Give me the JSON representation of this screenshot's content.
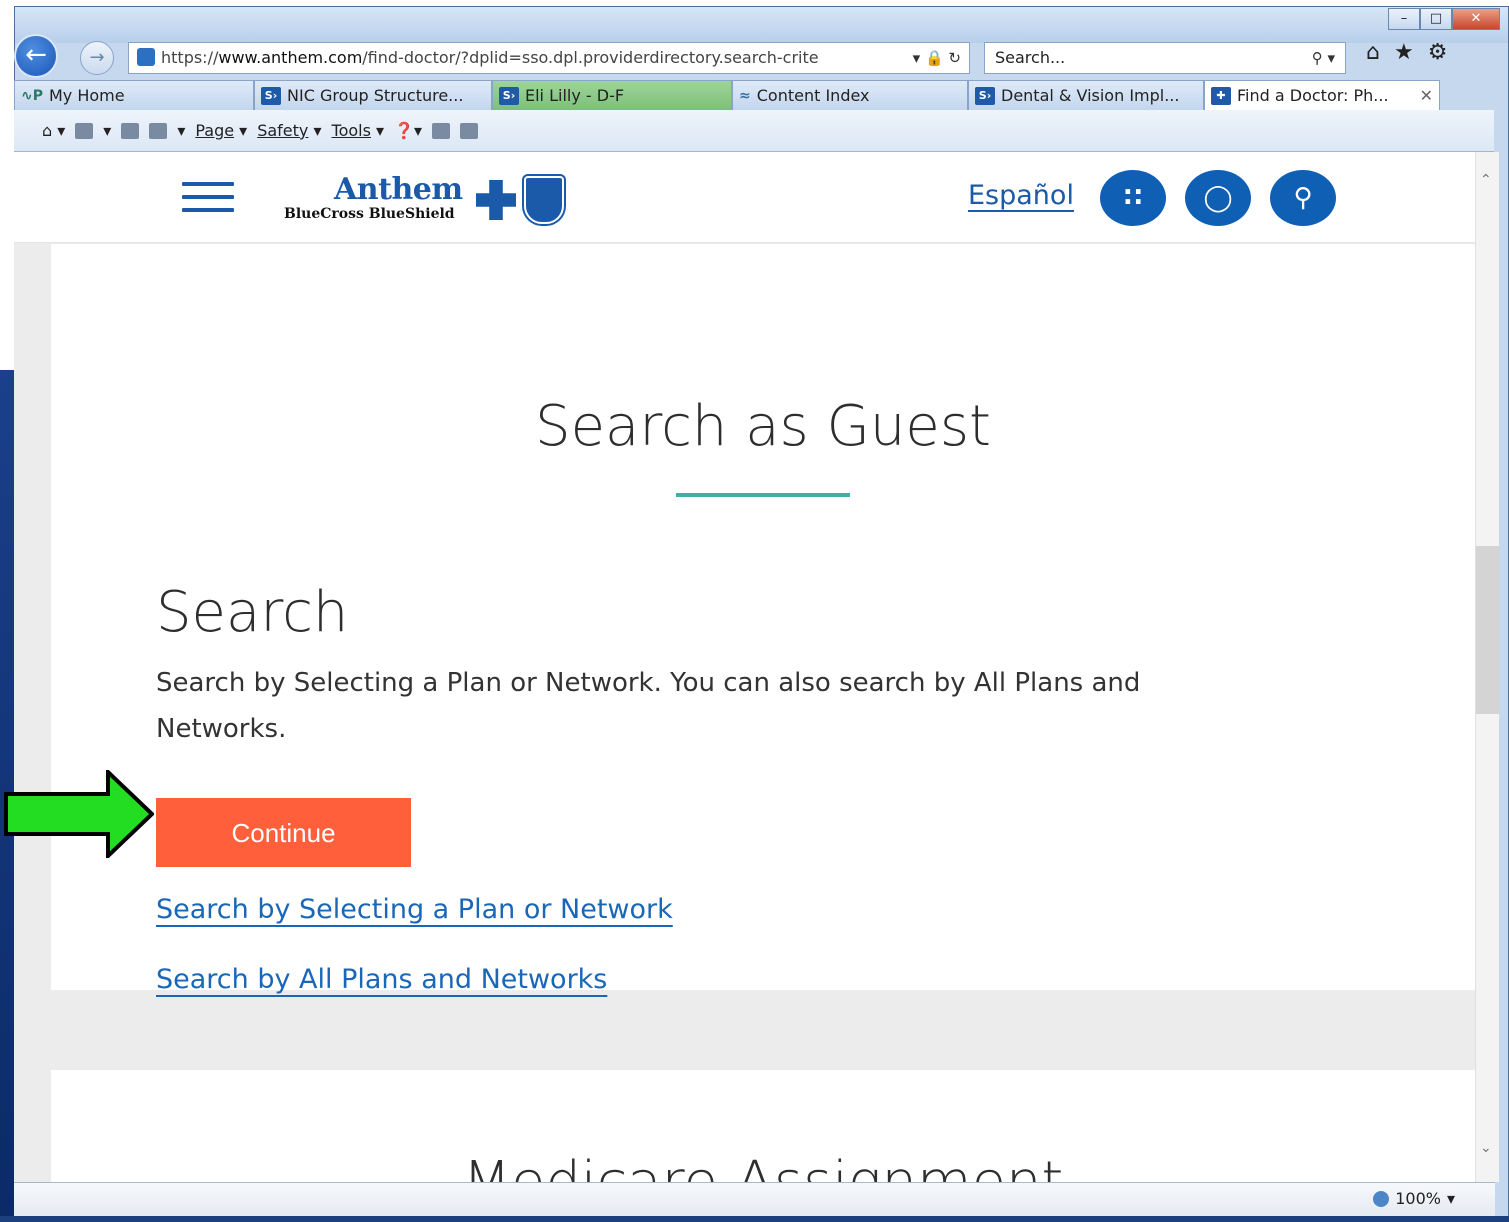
{
  "browser": {
    "url_prefix": "https://",
    "url_host": "www.anthem.com",
    "url_path": "/find-doctor/?dplid=sso.dpl.providerdirectory.search-crite",
    "search_placeholder": "Search...",
    "tabs": [
      {
        "label": "My Home",
        "icon": "home-page-icon"
      },
      {
        "label": "NIC Group Structure...",
        "icon": "sharepoint-icon"
      },
      {
        "label": "Eli Lilly - D-F",
        "icon": "sharepoint-icon"
      },
      {
        "label": "Content Index",
        "icon": "content-index-icon"
      },
      {
        "label": "Dental & Vision Impl...",
        "icon": "sharepoint-icon"
      },
      {
        "label": "Find a Doctor: Ph...",
        "icon": "anthem-icon"
      }
    ],
    "commands": {
      "page": "Page",
      "safety": "Safety",
      "tools": "Tools"
    },
    "zoom": "100%"
  },
  "site": {
    "brand_top": "Anthem",
    "brand_bottom": "BlueCross BlueShield",
    "language_link": "Español"
  },
  "main": {
    "title": "Search as Guest",
    "section_title": "Search",
    "description": "Search by Selecting a Plan or Network. You can also search by All Plans and Networks.",
    "continue_button": "Continue",
    "link_plan_network": "Search by Selecting a Plan or Network",
    "link_all_plans": "Search by All Plans and Networks",
    "next_section_title": "Medicare Assignment"
  },
  "colors": {
    "brand_blue": "#1a5aa8",
    "button_orange": "#ff5f3a",
    "accent_teal": "#3ab2a6",
    "annotation_green": "#22dd22"
  }
}
